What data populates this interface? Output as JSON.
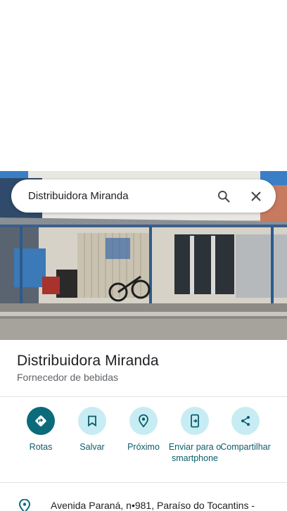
{
  "search": {
    "query": "Distribuidora Miranda"
  },
  "place": {
    "name": "Distribuidora Miranda",
    "category": "Fornecedor de bebidas"
  },
  "actions": [
    {
      "label": "Rotas",
      "icon": "directions-icon"
    },
    {
      "label": "Salvar",
      "icon": "bookmark-icon"
    },
    {
      "label": "Próximo",
      "icon": "nearby-icon"
    },
    {
      "label": "Enviar para o smartphone",
      "icon": "send-to-phone-icon"
    },
    {
      "label": "Compartilhar",
      "icon": "share-icon"
    }
  ],
  "address": {
    "text": "Avenida Paraná, n•981, Paraíso do Tocantins -"
  },
  "colors": {
    "accent": "#0b6b7a",
    "action_bg": "#c8ecf4",
    "label": "#0b5d6b"
  }
}
